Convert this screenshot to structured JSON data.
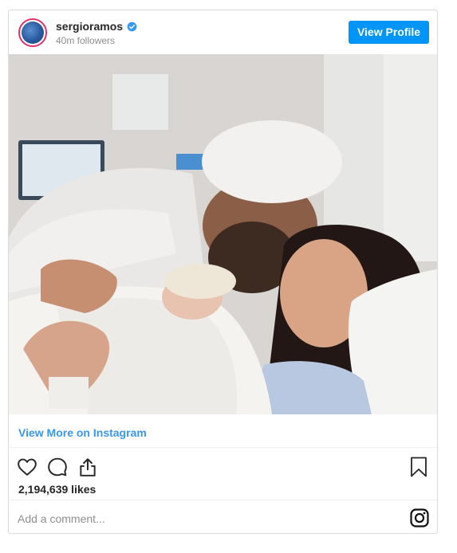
{
  "header": {
    "username": "sergioramos",
    "followers": "40m followers",
    "view_profile_label": "View Profile"
  },
  "post": {
    "view_more_label": "View More on Instagram",
    "likes": "2,194,639 likes",
    "comment_placeholder": "Add a comment..."
  },
  "colors": {
    "accent": "#0095f6",
    "link": "#3897f0",
    "verified": "#3897f0"
  },
  "icons": [
    "verified-badge-icon",
    "heart-icon",
    "comment-icon",
    "share-icon",
    "bookmark-icon",
    "instagram-logo-icon"
  ]
}
